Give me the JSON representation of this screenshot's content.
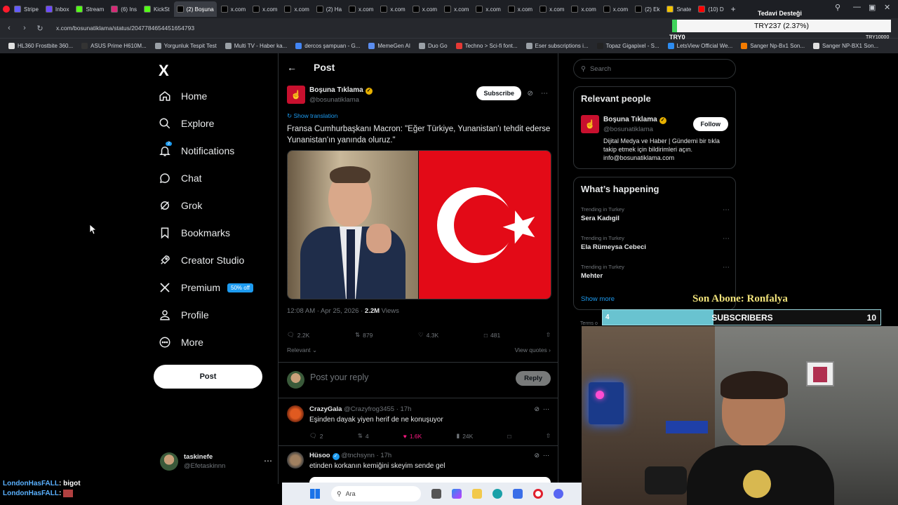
{
  "browser": {
    "tabs": [
      {
        "label": "Stripe",
        "color": "#635bff",
        "active": false
      },
      {
        "label": "Inbox",
        "color": "#6d4aff",
        "active": false
      },
      {
        "label": "Stream",
        "color": "#53fc18",
        "active": false
      },
      {
        "label": "(6) Ins",
        "color": "#d62976",
        "active": false
      },
      {
        "label": "KickSt",
        "color": "#53fc18",
        "active": false
      },
      {
        "label": "(2) Boşuna",
        "color": "#000000",
        "active": true
      },
      {
        "label": "x.com",
        "color": "#000000",
        "active": false
      },
      {
        "label": "x.com",
        "color": "#000000",
        "active": false
      },
      {
        "label": "x.com",
        "color": "#000000",
        "active": false
      },
      {
        "label": "(2) Ha",
        "color": "#000000",
        "active": false
      },
      {
        "label": "x.com",
        "color": "#000000",
        "active": false
      },
      {
        "label": "x.com",
        "color": "#000000",
        "active": false
      },
      {
        "label": "x.com",
        "color": "#000000",
        "active": false
      },
      {
        "label": "x.com",
        "color": "#000000",
        "active": false
      },
      {
        "label": "x.com",
        "color": "#000000",
        "active": false
      },
      {
        "label": "x.com",
        "color": "#000000",
        "active": false
      },
      {
        "label": "x.com",
        "color": "#000000",
        "active": false
      },
      {
        "label": "x.com",
        "color": "#000000",
        "active": false
      },
      {
        "label": "x.com",
        "color": "#000000",
        "active": false
      },
      {
        "label": "(2) Ek",
        "color": "#000000",
        "active": false
      },
      {
        "label": "Snate",
        "color": "#f2c200",
        "active": false
      },
      {
        "label": "(10) D",
        "color": "#ff0000",
        "active": false
      }
    ],
    "url": "x.com/bosunatiklama/status/2047784654451654793",
    "bookmarks": [
      {
        "label": "HL360 Frostbite 360...",
        "color": "#e0e0e0"
      },
      {
        "label": "ASUS Prime H610M...",
        "color": "#333333"
      },
      {
        "label": "Yorgunluk Tespit Test",
        "color": "#9aa0a6"
      },
      {
        "label": "Multi TV - Haber ka...",
        "color": "#9aa0a6"
      },
      {
        "label": "dercos şampuan - G...",
        "color": "#4285f4"
      },
      {
        "label": "MemeGen AI",
        "color": "#5b8def"
      },
      {
        "label": "Duo Go",
        "color": "#9aa0a6"
      },
      {
        "label": "Techno > Sci-fi font...",
        "color": "#e53935"
      },
      {
        "label": "Eser subscriptions i...",
        "color": "#9aa0a6"
      },
      {
        "label": "Topaz Gigapixel - S...",
        "color": "#222222"
      },
      {
        "label": "LetsView Official We...",
        "color": "#2d8cf0"
      },
      {
        "label": "Sanger Np-Bx1 Son...",
        "color": "#f57c00"
      },
      {
        "label": "Sanger NP-BX1 Son...",
        "color": "#e0e0e0"
      }
    ]
  },
  "nav": {
    "logo": "X",
    "items": [
      {
        "label": "Home",
        "icon": "home-icon"
      },
      {
        "label": "Explore",
        "icon": "search-icon"
      },
      {
        "label": "Notifications",
        "icon": "bell-icon"
      },
      {
        "label": "Chat",
        "icon": "chat-icon"
      },
      {
        "label": "Grok",
        "icon": "grok-icon"
      },
      {
        "label": "Bookmarks",
        "icon": "bookmark-icon"
      },
      {
        "label": "Creator Studio",
        "icon": "rocket-icon"
      },
      {
        "label": "Premium",
        "icon": "x-logo-icon"
      },
      {
        "label": "Profile",
        "icon": "person-icon"
      },
      {
        "label": "More",
        "icon": "more-circle-icon"
      }
    ],
    "notif_badge": "2",
    "premium_tag": "50% off",
    "post_button": "Post",
    "account_name": "taskinefe",
    "account_handle": "@Efetaskinnn"
  },
  "post": {
    "header": "Post",
    "author_name": "Boşuna Tıklama",
    "author_handle": "@bosunatiklama",
    "subscribe_label": "Subscribe",
    "show_translation": "Show translation",
    "text": "Fransa Cumhurbaşkanı Macron: \"Eğer Türkiye, Yunanistan'ı tehdit ederse Yunanistan'ın yanında oluruz.\"",
    "time": "12:08 AM · Apr 25, 2026 · ",
    "views_value": "2.2M",
    "views_label": " Views",
    "replies": "2.2K",
    "reposts": "879",
    "likes": "4.3K",
    "bookmarks": "481",
    "sort_label": "Relevant",
    "view_quotes": "View quotes",
    "reply_placeholder": "Post your reply",
    "reply_button": "Reply"
  },
  "comments": [
    {
      "name": "CrazyGala",
      "handle": "@Crazyfrog3455 · 17h",
      "text": "Eşinden dayak yiyen herif de ne konuşuyor",
      "replies": "2",
      "reposts": "4",
      "likes": "1.6K",
      "views": "24K"
    },
    {
      "name": "Hüsoo",
      "handle": "@tnchsynn · 17h",
      "text": "etinden korkanın kemiğini skeyim sende gel"
    }
  ],
  "sidebar": {
    "search_placeholder": "Search",
    "relevant_title": "Relevant people",
    "rel_name": "Boşuna Tıklama",
    "rel_handle": "@bosunatiklama",
    "follow_label": "Follow",
    "rel_bio": "Dijital Medya ve Haber | Gündemi bir tıkla takip etmek için bildirimleri açın. info@bosunatiklama.com",
    "happening_title": "What’s happening",
    "trends": [
      {
        "context": "Trending in Turkey",
        "name": "Sera Kadıgil"
      },
      {
        "context": "Trending in Turkey",
        "name": "Ela Rümeysa Cebeci"
      },
      {
        "context": "Trending in Turkey",
        "name": "Mehter"
      }
    ],
    "show_more": "Show more",
    "terms_fragment": "Terms o"
  },
  "overlay": {
    "ticker_label": "Tedavi Desteği",
    "ticker_value": "TRY237 (2.37%)",
    "ticker_progress": 0.0237,
    "ticker_low": "TRY0",
    "ticker_high": "TRY10000",
    "last_sub": "Son Abone: Ronfalya",
    "sub_current": "4",
    "sub_goal": "10",
    "sub_label": "SUBSCRIBERS",
    "sub_progress": 0.4,
    "chat": [
      {
        "user": "LondonHasFALL",
        "msg": ": bigot"
      },
      {
        "user": "LondonHasFALL",
        "msg": ": "
      }
    ]
  },
  "taskbar": {
    "search_placeholder": "Ara"
  },
  "colors": {
    "accent": "#1d9bf0",
    "brand_red": "#c8102e",
    "like_pink": "#f91880"
  }
}
